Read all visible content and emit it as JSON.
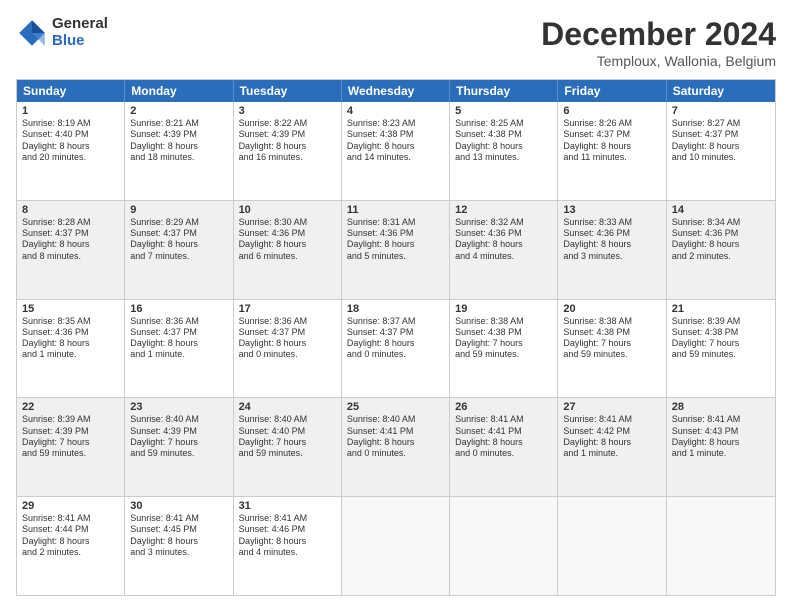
{
  "header": {
    "logo": {
      "general": "General",
      "blue": "Blue"
    },
    "title": "December 2024",
    "location": "Temploux, Wallonia, Belgium"
  },
  "weekdays": [
    "Sunday",
    "Monday",
    "Tuesday",
    "Wednesday",
    "Thursday",
    "Friday",
    "Saturday"
  ],
  "weeks": [
    {
      "shaded": false,
      "days": [
        {
          "num": "1",
          "lines": [
            "Sunrise: 8:19 AM",
            "Sunset: 4:40 PM",
            "Daylight: 8 hours",
            "and 20 minutes."
          ]
        },
        {
          "num": "2",
          "lines": [
            "Sunrise: 8:21 AM",
            "Sunset: 4:39 PM",
            "Daylight: 8 hours",
            "and 18 minutes."
          ]
        },
        {
          "num": "3",
          "lines": [
            "Sunrise: 8:22 AM",
            "Sunset: 4:39 PM",
            "Daylight: 8 hours",
            "and 16 minutes."
          ]
        },
        {
          "num": "4",
          "lines": [
            "Sunrise: 8:23 AM",
            "Sunset: 4:38 PM",
            "Daylight: 8 hours",
            "and 14 minutes."
          ]
        },
        {
          "num": "5",
          "lines": [
            "Sunrise: 8:25 AM",
            "Sunset: 4:38 PM",
            "Daylight: 8 hours",
            "and 13 minutes."
          ]
        },
        {
          "num": "6",
          "lines": [
            "Sunrise: 8:26 AM",
            "Sunset: 4:37 PM",
            "Daylight: 8 hours",
            "and 11 minutes."
          ]
        },
        {
          "num": "7",
          "lines": [
            "Sunrise: 8:27 AM",
            "Sunset: 4:37 PM",
            "Daylight: 8 hours",
            "and 10 minutes."
          ]
        }
      ]
    },
    {
      "shaded": true,
      "days": [
        {
          "num": "8",
          "lines": [
            "Sunrise: 8:28 AM",
            "Sunset: 4:37 PM",
            "Daylight: 8 hours",
            "and 8 minutes."
          ]
        },
        {
          "num": "9",
          "lines": [
            "Sunrise: 8:29 AM",
            "Sunset: 4:37 PM",
            "Daylight: 8 hours",
            "and 7 minutes."
          ]
        },
        {
          "num": "10",
          "lines": [
            "Sunrise: 8:30 AM",
            "Sunset: 4:36 PM",
            "Daylight: 8 hours",
            "and 6 minutes."
          ]
        },
        {
          "num": "11",
          "lines": [
            "Sunrise: 8:31 AM",
            "Sunset: 4:36 PM",
            "Daylight: 8 hours",
            "and 5 minutes."
          ]
        },
        {
          "num": "12",
          "lines": [
            "Sunrise: 8:32 AM",
            "Sunset: 4:36 PM",
            "Daylight: 8 hours",
            "and 4 minutes."
          ]
        },
        {
          "num": "13",
          "lines": [
            "Sunrise: 8:33 AM",
            "Sunset: 4:36 PM",
            "Daylight: 8 hours",
            "and 3 minutes."
          ]
        },
        {
          "num": "14",
          "lines": [
            "Sunrise: 8:34 AM",
            "Sunset: 4:36 PM",
            "Daylight: 8 hours",
            "and 2 minutes."
          ]
        }
      ]
    },
    {
      "shaded": false,
      "days": [
        {
          "num": "15",
          "lines": [
            "Sunrise: 8:35 AM",
            "Sunset: 4:36 PM",
            "Daylight: 8 hours",
            "and 1 minute."
          ]
        },
        {
          "num": "16",
          "lines": [
            "Sunrise: 8:36 AM",
            "Sunset: 4:37 PM",
            "Daylight: 8 hours",
            "and 1 minute."
          ]
        },
        {
          "num": "17",
          "lines": [
            "Sunrise: 8:36 AM",
            "Sunset: 4:37 PM",
            "Daylight: 8 hours",
            "and 0 minutes."
          ]
        },
        {
          "num": "18",
          "lines": [
            "Sunrise: 8:37 AM",
            "Sunset: 4:37 PM",
            "Daylight: 8 hours",
            "and 0 minutes."
          ]
        },
        {
          "num": "19",
          "lines": [
            "Sunrise: 8:38 AM",
            "Sunset: 4:38 PM",
            "Daylight: 7 hours",
            "and 59 minutes."
          ]
        },
        {
          "num": "20",
          "lines": [
            "Sunrise: 8:38 AM",
            "Sunset: 4:38 PM",
            "Daylight: 7 hours",
            "and 59 minutes."
          ]
        },
        {
          "num": "21",
          "lines": [
            "Sunrise: 8:39 AM",
            "Sunset: 4:38 PM",
            "Daylight: 7 hours",
            "and 59 minutes."
          ]
        }
      ]
    },
    {
      "shaded": true,
      "days": [
        {
          "num": "22",
          "lines": [
            "Sunrise: 8:39 AM",
            "Sunset: 4:39 PM",
            "Daylight: 7 hours",
            "and 59 minutes."
          ]
        },
        {
          "num": "23",
          "lines": [
            "Sunrise: 8:40 AM",
            "Sunset: 4:39 PM",
            "Daylight: 7 hours",
            "and 59 minutes."
          ]
        },
        {
          "num": "24",
          "lines": [
            "Sunrise: 8:40 AM",
            "Sunset: 4:40 PM",
            "Daylight: 7 hours",
            "and 59 minutes."
          ]
        },
        {
          "num": "25",
          "lines": [
            "Sunrise: 8:40 AM",
            "Sunset: 4:41 PM",
            "Daylight: 8 hours",
            "and 0 minutes."
          ]
        },
        {
          "num": "26",
          "lines": [
            "Sunrise: 8:41 AM",
            "Sunset: 4:41 PM",
            "Daylight: 8 hours",
            "and 0 minutes."
          ]
        },
        {
          "num": "27",
          "lines": [
            "Sunrise: 8:41 AM",
            "Sunset: 4:42 PM",
            "Daylight: 8 hours",
            "and 1 minute."
          ]
        },
        {
          "num": "28",
          "lines": [
            "Sunrise: 8:41 AM",
            "Sunset: 4:43 PM",
            "Daylight: 8 hours",
            "and 1 minute."
          ]
        }
      ]
    },
    {
      "shaded": false,
      "days": [
        {
          "num": "29",
          "lines": [
            "Sunrise: 8:41 AM",
            "Sunset: 4:44 PM",
            "Daylight: 8 hours",
            "and 2 minutes."
          ]
        },
        {
          "num": "30",
          "lines": [
            "Sunrise: 8:41 AM",
            "Sunset: 4:45 PM",
            "Daylight: 8 hours",
            "and 3 minutes."
          ]
        },
        {
          "num": "31",
          "lines": [
            "Sunrise: 8:41 AM",
            "Sunset: 4:46 PM",
            "Daylight: 8 hours",
            "and 4 minutes."
          ]
        },
        null,
        null,
        null,
        null
      ]
    }
  ]
}
